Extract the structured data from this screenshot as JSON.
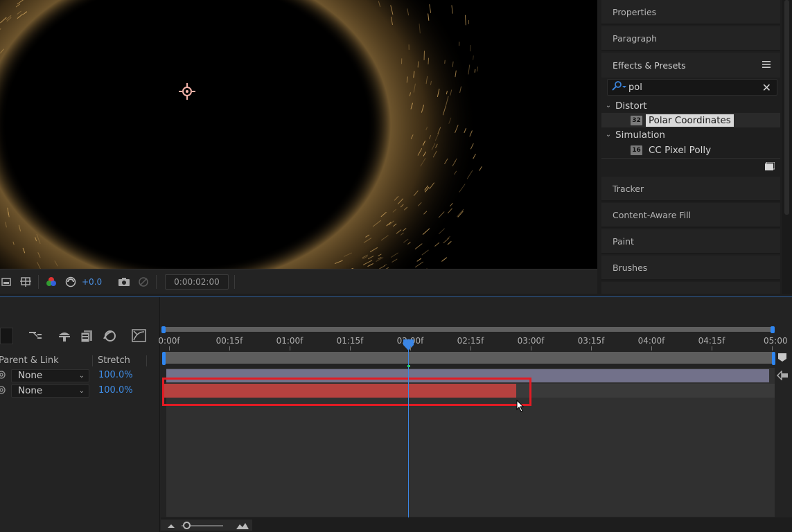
{
  "viewer": {
    "exposure": "+0.0",
    "timecode": "0:00:02:00",
    "toolbar_icons": [
      "region-of-interest-icon",
      "transparency-grid-icon",
      "channel-rgb-icon",
      "reset-exposure-icon",
      "snapshot-camera-icon",
      "show-snapshot-icon"
    ]
  },
  "right_panel": {
    "properties": "Properties",
    "paragraph": "Paragraph",
    "effects_presets": "Effects & Presets",
    "search_value": "pol",
    "categories": [
      {
        "name": "Distort",
        "items": [
          {
            "label": "Polar Coordinates",
            "badge": "32",
            "selected": true
          }
        ]
      },
      {
        "name": "Simulation",
        "items": [
          {
            "label": "CC Pixel Polly",
            "badge": "16",
            "selected": false
          }
        ]
      }
    ],
    "tracker": "Tracker",
    "content_aware_fill": "Content-Aware Fill",
    "paint": "Paint",
    "brushes": "Brushes"
  },
  "timeline": {
    "columns": {
      "parent_link": "Parent & Link",
      "stretch": "Stretch"
    },
    "layers": [
      {
        "parent": "None",
        "stretch": "100.0%"
      },
      {
        "parent": "None",
        "stretch": "100.0%"
      }
    ],
    "ruler": [
      "0:00f",
      "00:15f",
      "01:00f",
      "01:15f",
      "02:00f",
      "02:15f",
      "03:00f",
      "03:15f",
      "04:00f",
      "04:15f",
      "05:00"
    ],
    "current_time": "02:00f"
  },
  "colors": {
    "accent_blue": "#2f86f0",
    "layer2_bar": "#b5413f",
    "layer1_bar": "#72718a",
    "highlight": "#e21b24"
  }
}
